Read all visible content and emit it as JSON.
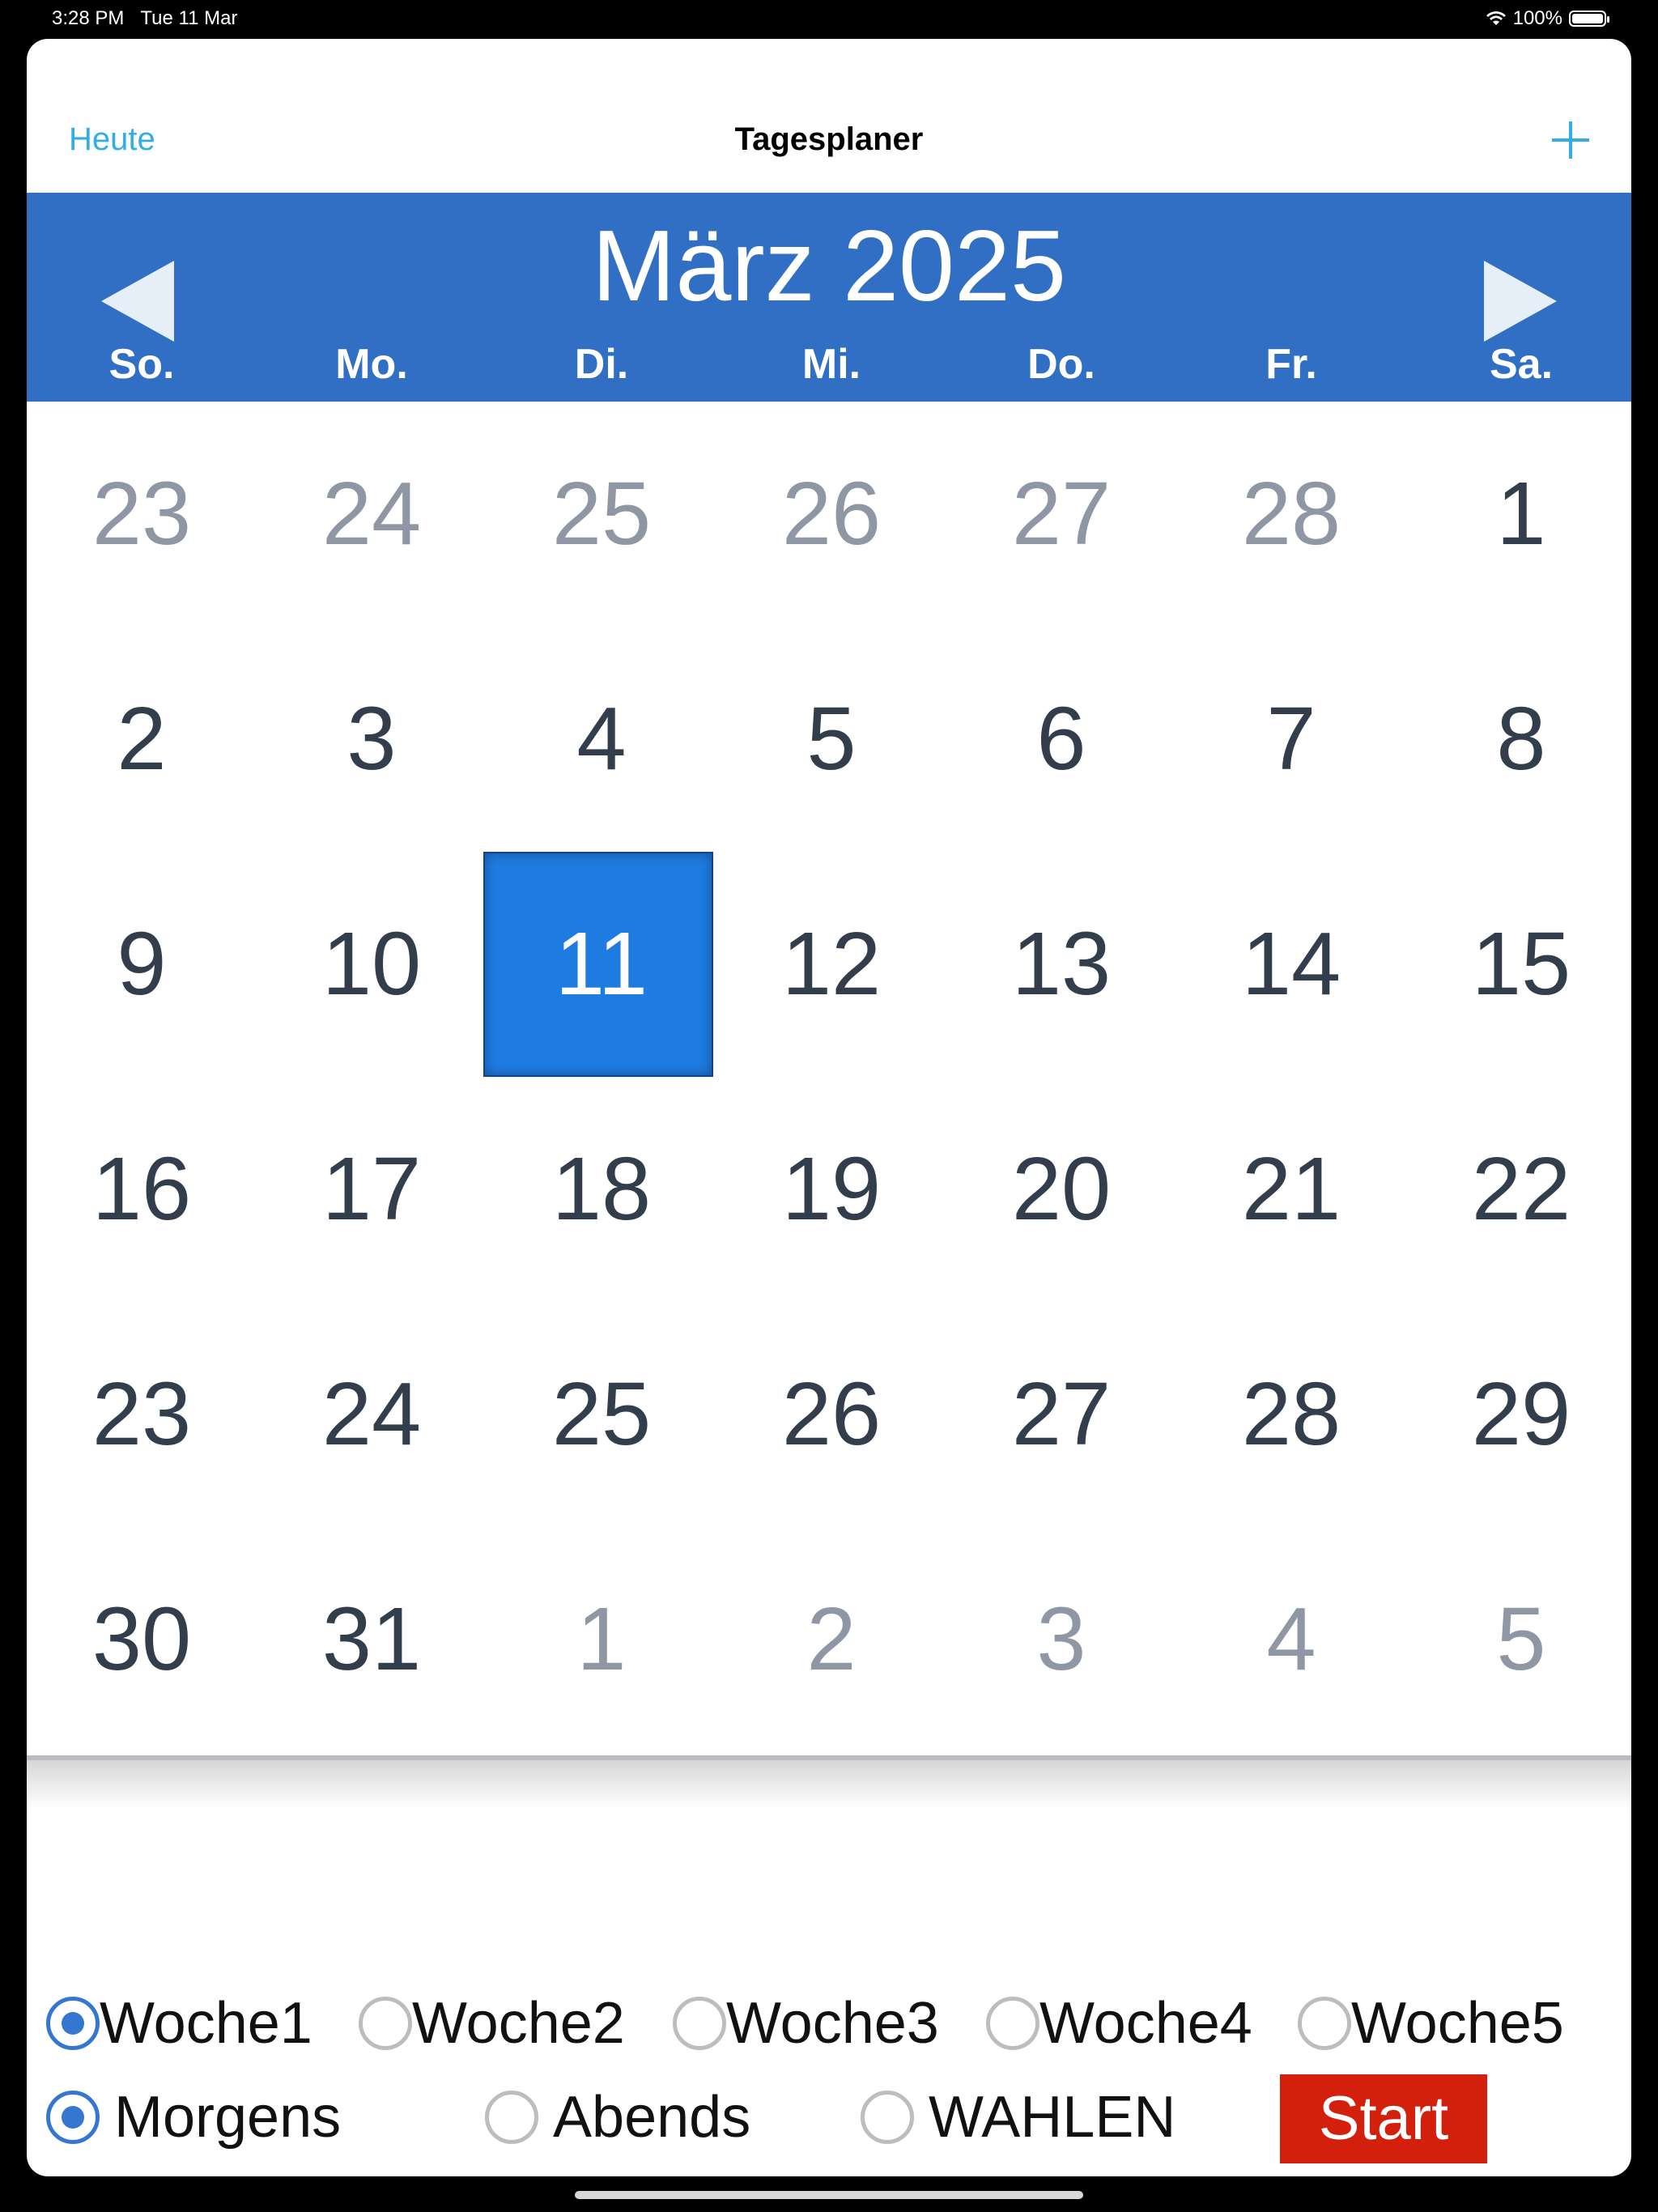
{
  "status_bar": {
    "time": "3:28 PM",
    "date": "Tue 11 Mar",
    "battery": "100%",
    "battery_level": 1.0
  },
  "nav": {
    "today_label": "Heute",
    "title": "Tagesplaner",
    "add_icon": "plus-icon"
  },
  "calendar": {
    "month_title": "März 2025",
    "prev_icon": "triangle-left-icon",
    "next_icon": "triangle-right-icon",
    "weekdays": [
      "So.",
      "Mo.",
      "Di.",
      "Mi.",
      "Do.",
      "Fr.",
      "Sa."
    ],
    "weeks": [
      [
        "23",
        "24",
        "25",
        "26",
        "27",
        "28",
        "1"
      ],
      [
        "2",
        "3",
        "4",
        "5",
        "6",
        "7",
        "8"
      ],
      [
        "9",
        "10",
        "11",
        "12",
        "13",
        "14",
        "15"
      ],
      [
        "16",
        "17",
        "18",
        "19",
        "20",
        "21",
        "22"
      ],
      [
        "23",
        "24",
        "25",
        "26",
        "27",
        "28",
        "29"
      ],
      [
        "30",
        "31",
        "1",
        "2",
        "3",
        "4",
        "5"
      ]
    ],
    "selected_day": "11",
    "colors": {
      "header": "#316fc4",
      "selected": "#1e7be0",
      "current_month_text": "#333e4c",
      "other_month_text": "#8e97a3"
    }
  },
  "options": {
    "weeks": [
      {
        "label": "Woche1",
        "checked": true
      },
      {
        "label": "Woche2",
        "checked": false
      },
      {
        "label": "Woche3",
        "checked": false
      },
      {
        "label": "Woche4",
        "checked": false
      },
      {
        "label": "Woche5",
        "checked": false
      }
    ],
    "times": [
      {
        "label": "Morgens",
        "checked": true
      },
      {
        "label": "Abends",
        "checked": false
      },
      {
        "label": "WAHLEN",
        "checked": false
      }
    ],
    "start_label": "Start",
    "start_color": "#d3200c"
  }
}
